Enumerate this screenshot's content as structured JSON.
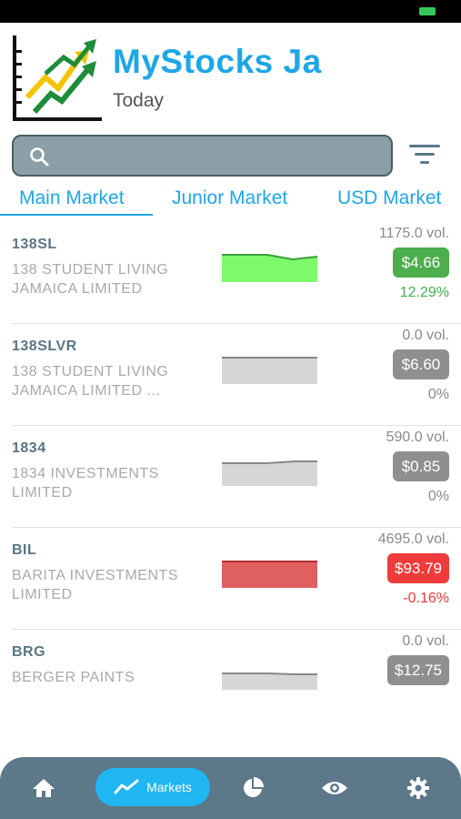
{
  "app": {
    "title": "MyStocks Ja",
    "subtitle": "Today"
  },
  "search": {
    "placeholder": ""
  },
  "tabs": [
    {
      "label": "Main Market",
      "active": true
    },
    {
      "label": "Junior Market",
      "active": false
    },
    {
      "label": "USD Market",
      "active": false
    }
  ],
  "stocks": [
    {
      "symbol": "138SL",
      "name": "138 STUDENT LIVING JAMAICA LIMITED",
      "volume": "1175.0 vol.",
      "price": "$4.66",
      "change": "12.29%",
      "trend": "up",
      "color": "#4cae4c",
      "pct_color": "#3fb24a",
      "spark_fill": "#7dfa6b",
      "spark_line": "#3aa13a"
    },
    {
      "symbol": "138SLVR",
      "name": "138 STUDENT LIVING JAMAICA LIMITED ...",
      "volume": "0.0 vol.",
      "price": "$6.60",
      "change": "0%",
      "trend": "flat",
      "color": "#8f8f8f",
      "pct_color": "#8a8a8a",
      "spark_fill": "#d6d6d6",
      "spark_line": "#888888"
    },
    {
      "symbol": "1834",
      "name": "1834 INVESTMENTS LIMITED",
      "volume": "590.0 vol.",
      "price": "$0.85",
      "change": "0%",
      "trend": "flat",
      "color": "#8f8f8f",
      "pct_color": "#8a8a8a",
      "spark_fill": "#d6d6d6",
      "spark_line": "#888888"
    },
    {
      "symbol": "BIL",
      "name": "BARITA INVESTMENTS LIMITED",
      "volume": "4695.0 vol.",
      "price": "$93.79",
      "change": "-0.16%",
      "trend": "down",
      "color": "#ef3b3b",
      "pct_color": "#e53935",
      "spark_fill": "#e06060",
      "spark_line": "#b03030"
    },
    {
      "symbol": "BRG",
      "name": "BERGER PAINTS",
      "volume": "0.0 vol.",
      "price": "$12.75",
      "change": "",
      "trend": "flat",
      "color": "#8f8f8f",
      "pct_color": "#8a8a8a",
      "spark_fill": "#d6d6d6",
      "spark_line": "#888888"
    }
  ],
  "nav": {
    "items": [
      {
        "icon": "home-icon",
        "label": ""
      },
      {
        "icon": "chart-line-icon",
        "label": "Markets",
        "active": true
      },
      {
        "icon": "pie-chart-icon",
        "label": ""
      },
      {
        "icon": "eye-icon",
        "label": ""
      },
      {
        "icon": "gear-icon",
        "label": ""
      }
    ]
  },
  "colors": {
    "accent": "#1fa6e6",
    "nav_bg": "#5d7888",
    "nav_active": "#1fb6f2"
  }
}
